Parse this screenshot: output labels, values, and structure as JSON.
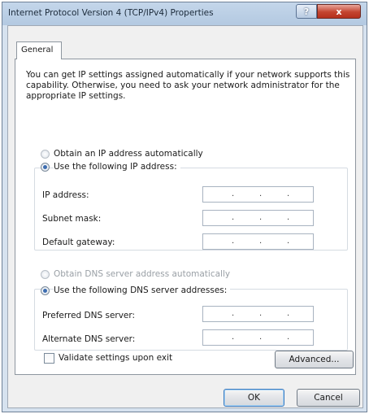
{
  "window": {
    "title": "Internet Protocol Version 4 (TCP/IPv4) Properties",
    "help_glyph": "?",
    "close_glyph": "x"
  },
  "tabs": [
    {
      "label": "General",
      "selected": true
    }
  ],
  "description": "You can get IP settings assigned automatically if your network supports this capability. Otherwise, you need to ask your network administrator for the appropriate IP settings.",
  "ip": {
    "auto_label": "Obtain an IP address automatically",
    "manual_label": "Use the following IP address:",
    "selected": "manual",
    "fields": [
      {
        "label": "IP address:",
        "value": ". . ."
      },
      {
        "label": "Subnet mask:",
        "value": ". . ."
      },
      {
        "label": "Default gateway:",
        "value": ". . ."
      }
    ]
  },
  "dns": {
    "auto_label": "Obtain DNS server address automatically",
    "manual_label": "Use the following DNS server addresses:",
    "selected": "manual",
    "fields": [
      {
        "label": "Preferred DNS server:",
        "value": ". . ."
      },
      {
        "label": "Alternate DNS server:",
        "value": ". . ."
      }
    ]
  },
  "validate": {
    "label": "Validate settings upon exit",
    "checked": false
  },
  "buttons": {
    "advanced": "Advanced...",
    "ok": "OK",
    "cancel": "Cancel"
  },
  "colors": {
    "title_bar": "#b8cde4",
    "close_button": "#c4442f",
    "radio_dot": "#3d6db0"
  }
}
